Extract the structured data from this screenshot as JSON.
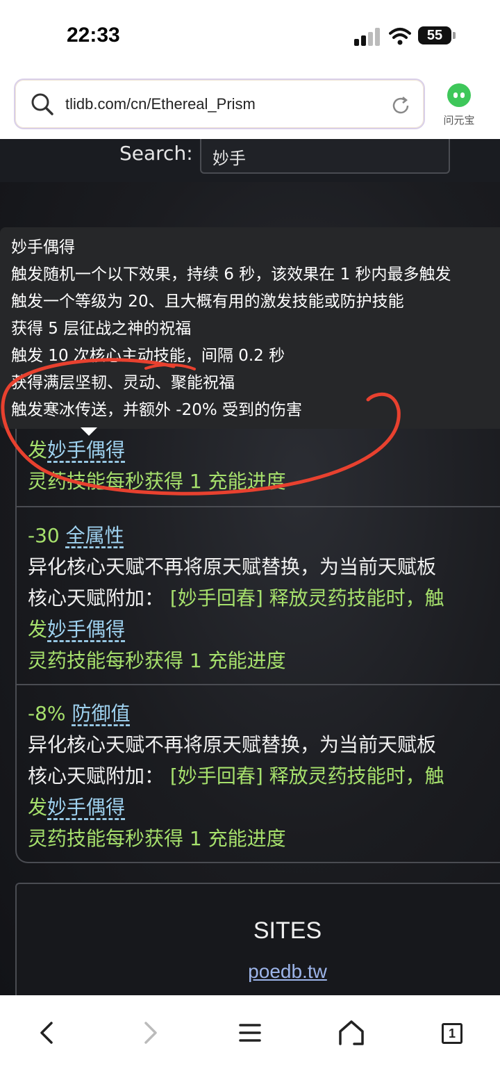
{
  "status": {
    "time": "22:33",
    "battery": "55"
  },
  "address_bar": {
    "url": "tlidb.com/cn/Ethereal_Prism",
    "assistant_label": "问元宝"
  },
  "search": {
    "label": "Search:",
    "value": "妙手"
  },
  "tooltip": {
    "lines": [
      "妙手偶得",
      "触发随机一个以下效果，持续 6 秒，该效果在 1 秒内最多触发",
      "触发一个等级为 20、且大概有用的激发技能或防护技能",
      "获得 5 层征战之神的祝福",
      "触发 10 次核心主动技能，间隔 0.2 秒",
      "获得满层坚韧、灵动、聚能祝福",
      "触发寒冰传送，并额外 -20% 受到的伤害"
    ]
  },
  "entries": [
    {
      "stat_value": "",
      "stat_link": "",
      "desc_line": "",
      "core_prefix": "",
      "core_text": "",
      "trigger_prefix": "发",
      "trigger_link": "妙手偶得",
      "progress": "灵药技能每秒获得 1 充能进度"
    },
    {
      "stat_value": "-30",
      "stat_link": "全属性",
      "desc_line": "异化核心天赋不再将原天赋替换，为当前天赋板",
      "core_prefix": "核心天赋附加：",
      "core_text": "[妙手回春] 释放灵药技能时，触",
      "trigger_prefix": "发",
      "trigger_link": "妙手偶得",
      "progress": "灵药技能每秒获得 1 充能进度"
    },
    {
      "stat_value": "-8%",
      "stat_link": "防御值",
      "desc_line": "异化核心天赋不再将原天赋替换，为当前天赋板",
      "core_prefix": "核心天赋附加：",
      "core_text": "[妙手回春] 释放灵药技能时，触",
      "trigger_prefix": "发",
      "trigger_link": "妙手偶得",
      "progress": "灵药技能每秒获得 1 充能进度"
    }
  ],
  "sites": {
    "title": "SITES",
    "link": "poedb.tw"
  },
  "colors": {
    "green_text": "#a6e06c",
    "link": "#9fd2f0",
    "annotation": "#e8412f"
  },
  "icons": [
    "search-icon",
    "reload-icon",
    "back-icon",
    "forward-icon",
    "menu-icon",
    "home-icon",
    "tabs-icon"
  ],
  "toolbar": {
    "tab_count": "1"
  }
}
